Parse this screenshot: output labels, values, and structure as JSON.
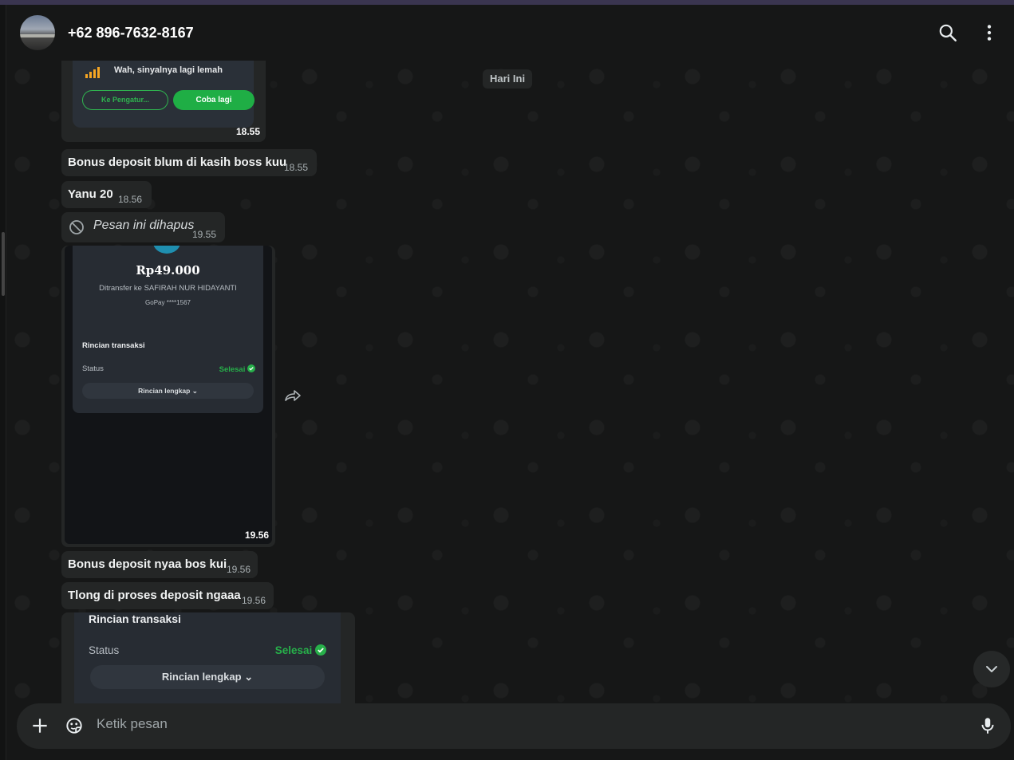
{
  "header": {
    "contact_name": "+62 896-7632-8167",
    "search_icon": "search-icon",
    "menu_icon": "more-vertical-icon"
  },
  "chat": {
    "date_separator": "Hari Ini",
    "messages": [
      {
        "type": "image",
        "embedded": {
          "warning": "Wah, sinyalnya lagi lemah",
          "btn_settings": "Ke Pengatur...",
          "btn_retry": "Coba lagi"
        },
        "time": "18.55"
      },
      {
        "type": "text",
        "text": "Bonus deposit blum di kasih boss kuu",
        "time": "18.55"
      },
      {
        "type": "text",
        "text": "Yanu 20",
        "time": "18.56"
      },
      {
        "type": "deleted",
        "text": "Pesan ini dihapus",
        "time": "19.55"
      },
      {
        "type": "image",
        "embedded": {
          "amount": "Rp49.000",
          "recipient": "Ditransfer ke SAFIRAH NUR HIDAYANTI",
          "account": "GoPay ****1567",
          "section": "Rincian transaksi",
          "status_label": "Status",
          "status_value": "Selesai",
          "detail_button": "Rincian lengkap"
        },
        "time": "19.56"
      },
      {
        "type": "text",
        "text": "Bonus deposit nyaa bos kui",
        "time": "19.56"
      },
      {
        "type": "text",
        "text": "Tlong di proses deposit ngaaa",
        "time": "19.56"
      },
      {
        "type": "image",
        "embedded": {
          "section": "Rincian transaksi",
          "status_label": "Status",
          "status_value": "Selesai",
          "detail_button": "Rincian lengkap"
        }
      }
    ]
  },
  "composer": {
    "placeholder": "Ketik pesan",
    "attach_icon": "plus-icon",
    "sticker_icon": "sticker-icon",
    "mic_icon": "microphone-icon"
  },
  "colors": {
    "background": "#161717",
    "bubble": "#242626",
    "success": "#27b04a",
    "warning": "#f6a623"
  }
}
